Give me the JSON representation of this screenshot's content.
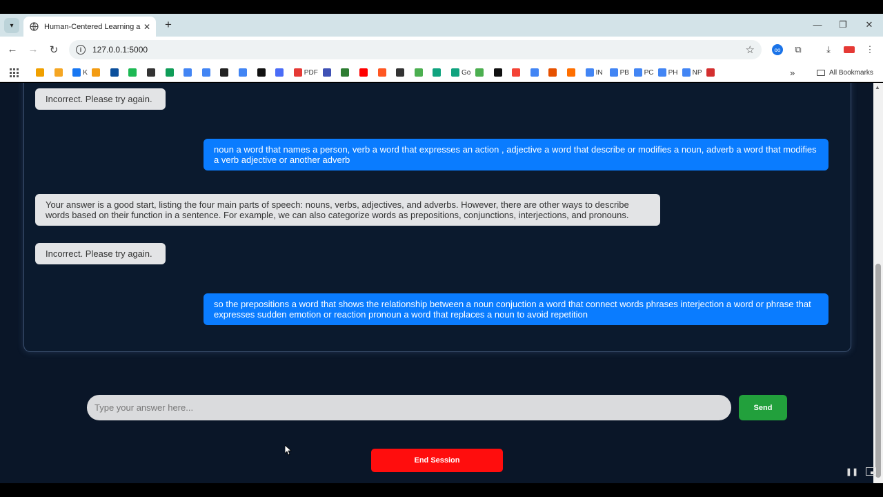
{
  "browser": {
    "tab_title": "Human-Centered Learning and",
    "url": "127.0.0.1:5000",
    "bookmarks": [
      {
        "label": "",
        "color": "#f0a000"
      },
      {
        "label": "",
        "color": "#f5a623"
      },
      {
        "label": "K",
        "color": "#1877f2"
      },
      {
        "label": "",
        "color": "#f39c12"
      },
      {
        "label": "",
        "color": "#0b4f9c"
      },
      {
        "label": "",
        "color": "#1db954"
      },
      {
        "label": "",
        "color": "#333333"
      },
      {
        "label": "",
        "color": "#0f9d58"
      },
      {
        "label": "",
        "color": "#4285f4"
      },
      {
        "label": "",
        "color": "#4285f4"
      },
      {
        "label": "",
        "color": "#222222"
      },
      {
        "label": "",
        "color": "#4285f4"
      },
      {
        "label": "",
        "color": "#111111"
      },
      {
        "label": "",
        "color": "#4a6cf7"
      },
      {
        "label": "PDF",
        "color": "#e53935"
      },
      {
        "label": "",
        "color": "#3f51b5"
      },
      {
        "label": "",
        "color": "#2e7d32"
      },
      {
        "label": "",
        "color": "#ff0000"
      },
      {
        "label": "",
        "color": "#ff5722"
      },
      {
        "label": "",
        "color": "#333333"
      },
      {
        "label": "",
        "color": "#4caf50"
      },
      {
        "label": "",
        "color": "#10a37f"
      },
      {
        "label": "Go",
        "color": "#10a37f"
      },
      {
        "label": "",
        "color": "#4caf50"
      },
      {
        "label": "",
        "color": "#111111"
      },
      {
        "label": "",
        "color": "#f44336"
      },
      {
        "label": "",
        "color": "#4285f4"
      },
      {
        "label": "",
        "color": "#e65100"
      },
      {
        "label": "",
        "color": "#ff6f00"
      },
      {
        "label": "IN",
        "color": "#4285f4"
      },
      {
        "label": "PB",
        "color": "#4285f4"
      },
      {
        "label": "PC",
        "color": "#4285f4"
      },
      {
        "label": "PH",
        "color": "#4285f4"
      },
      {
        "label": "NP",
        "color": "#4285f4"
      },
      {
        "label": "",
        "color": "#d32f2f"
      }
    ],
    "all_bookmarks_label": "All Bookmarks",
    "more_bookmarks": "»"
  },
  "chat": {
    "messages": [
      {
        "role": "bot",
        "text": "Incorrect. Please try again."
      },
      {
        "role": "user",
        "text": "noun a word that names a person, verb a word that expresses an action , adjective a word that describe or modifies a noun, adverb a word that modifies a verb adjective or another adverb"
      },
      {
        "role": "bot",
        "text": "Your answer is a good start, listing the four main parts of speech: nouns, verbs, adjectives, and adverbs. However, there are other ways to describe words based on their function in a sentence. For example, we can also categorize words as prepositions, conjunctions, interjections, and pronouns."
      },
      {
        "role": "bot",
        "text": "Incorrect. Please try again."
      },
      {
        "role": "user",
        "text": "so the prepositions a word that shows the relationship between a noun conjuction a word that connect words phrases interjection a word or phrase that expresses sudden emotion or reaction pronoun a word that replaces a noun to avoid repetition"
      }
    ]
  },
  "composer": {
    "placeholder": "Type your answer here...",
    "value": "",
    "send_label": "Send"
  },
  "end_session_label": "End Session",
  "colors": {
    "page_bg": "#0a1628",
    "user_bubble": "#0a7cff",
    "bot_bubble": "#e3e4e6",
    "send_button": "#22a03c",
    "end_button": "#ff0d0d"
  }
}
